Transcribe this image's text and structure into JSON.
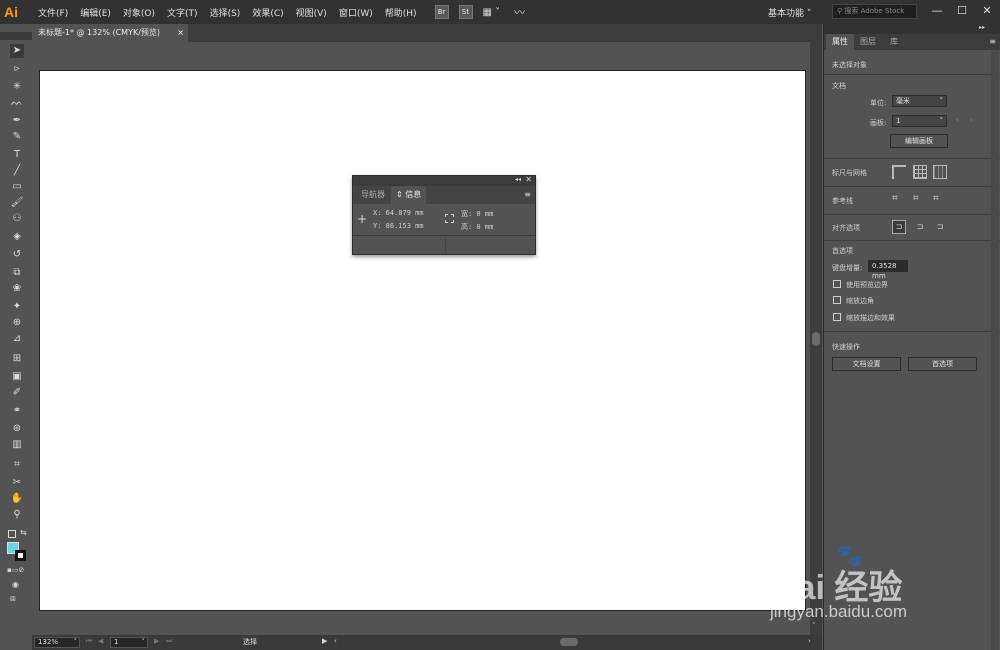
{
  "app": {
    "logo": "Ai",
    "accent": "#ff9a00"
  },
  "menubar": {
    "items": [
      "文件(F)",
      "编辑(E)",
      "对象(O)",
      "文字(T)",
      "选择(S)",
      "效果(C)",
      "视图(V)",
      "窗口(W)",
      "帮助(H)"
    ],
    "bridge": "Br",
    "stock": "St",
    "workspace": "基本功能",
    "search_placeholder": "搜索 Adobe Stock"
  },
  "document": {
    "tab_title": "未标题-1* @ 132% (CMYK/预览)",
    "close": "×"
  },
  "info_panel": {
    "tabs": [
      "导航器",
      "信息"
    ],
    "active_tab": "信息",
    "x": "X:  64.879 mm",
    "y": "Y:  86.153 mm",
    "w": "宽:  0 mm",
    "h": "高:  0 mm"
  },
  "properties": {
    "tabs": [
      "属性",
      "图层",
      "库"
    ],
    "no_selection": "未选择对象",
    "doc_section": "文档",
    "unit_label": "单位:",
    "unit_value": "毫米",
    "artboard_label": "画板:",
    "artboard_value": "1",
    "edit_artboards": "编辑画板",
    "rulers_grids": "标尺与网格",
    "guides": "参考线",
    "snap": "对齐选项",
    "prefs": "首选项",
    "keyboard_increment_label": "键盘增量:",
    "keyboard_increment_value": "0.3528 mm",
    "checkboxes": [
      "使用预览边界",
      "缩放边角",
      "缩放描边和效果"
    ],
    "quick_actions": "快速操作",
    "doc_setup": "文档设置",
    "preferences_btn": "首选项"
  },
  "statusbar": {
    "zoom": "132%",
    "artboard": "1",
    "mode": "选择"
  },
  "watermark": {
    "big": "Bai 经验",
    "url": "jingyan.baidu.com"
  }
}
